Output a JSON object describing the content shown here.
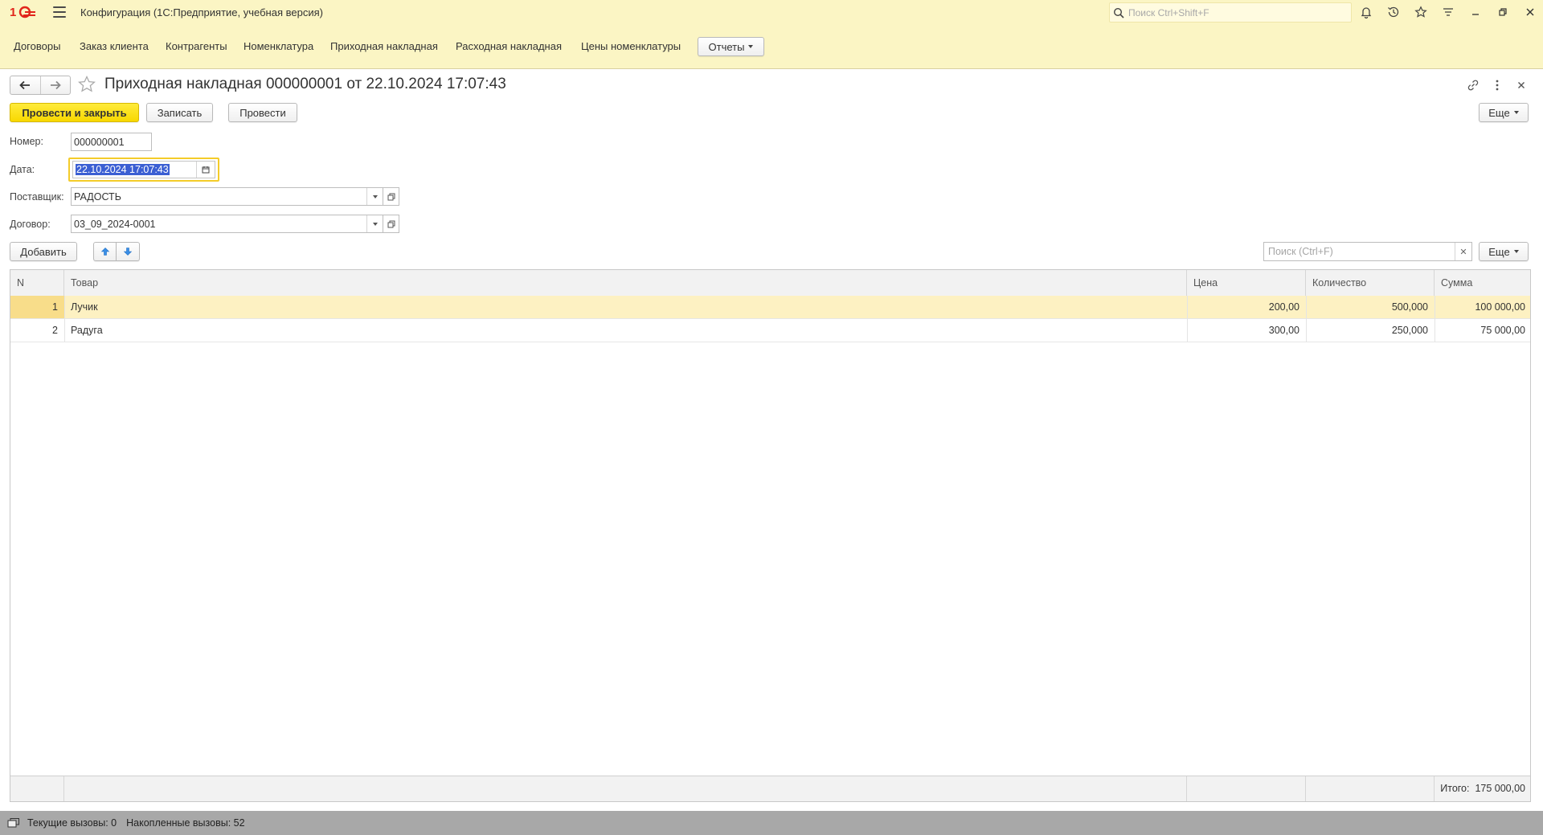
{
  "app": {
    "logo_text": "1С",
    "title": "Конфигурация  (1С:Предприятие, учебная версия)",
    "search_placeholder": "Поиск Ctrl+Shift+F",
    "brand_color": "#e1251b"
  },
  "sections": {
    "items": [
      "Договоры",
      "Заказ клиента",
      "Контрагенты",
      "Номенклатура",
      "Приходная накладная",
      "Расходная накладная",
      "Цены номенклатуры"
    ],
    "reports_label": "Отчеты"
  },
  "document": {
    "title": "Приходная накладная 000000001 от 22.10.2024 17:07:43",
    "post_close_label": "Провести и закрыть",
    "save_label": "Записать",
    "post_label": "Провести",
    "more_label": "Еще"
  },
  "form": {
    "number_label": "Номер:",
    "number_value": "000000001",
    "date_label": "Дата:",
    "date_value": "22.10.2024 17:07:43",
    "supplier_label": "Поставщик:",
    "supplier_value": "РАДОСТЬ",
    "contract_label": "Договор:",
    "contract_value": "03_09_2024-0001"
  },
  "table": {
    "add_label": "Добавить",
    "search_placeholder": "Поиск (Ctrl+F)",
    "more_label": "Еще",
    "columns": [
      "N",
      "Товар",
      "Цена",
      "Количество",
      "Сумма"
    ],
    "rows": [
      {
        "n": "1",
        "item": "Лучик",
        "price": "200,00",
        "qty": "500,000",
        "sum": "100 000,00"
      },
      {
        "n": "2",
        "item": "Радуга",
        "price": "300,00",
        "qty": "250,000",
        "sum": "75 000,00"
      }
    ],
    "total_label": "Итого:",
    "total_value": "175 000,00",
    "selected_row_color": "#fdf1c2"
  },
  "status": {
    "current_calls": "Текущие вызовы: 0",
    "accumulated_calls": "Накопленные вызовы: 52"
  }
}
